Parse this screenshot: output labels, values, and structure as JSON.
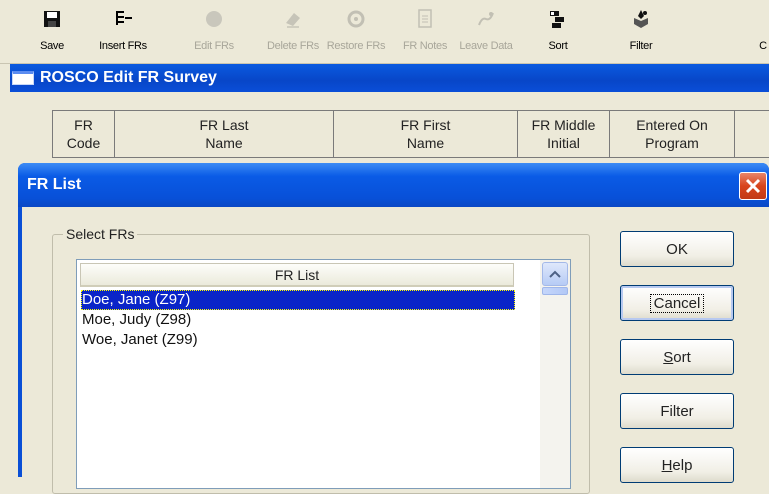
{
  "toolbar": {
    "items": [
      {
        "label": "Save",
        "icon": "floppy-disk-icon",
        "enabled": true
      },
      {
        "label": "Insert FRs",
        "icon": "insert-rows-icon",
        "enabled": true
      },
      {
        "label": "Edit FRs",
        "icon": "edit-circle-icon",
        "enabled": false
      },
      {
        "label": "Delete FRs",
        "icon": "eraser-icon",
        "enabled": false
      },
      {
        "label": "Restore FRs",
        "icon": "restore-icon",
        "enabled": false
      },
      {
        "label": "FR Notes",
        "icon": "notes-icon",
        "enabled": false
      },
      {
        "label": "Leave Data",
        "icon": "leave-icon",
        "enabled": false
      },
      {
        "label": "Sort",
        "icon": "sort-icon",
        "enabled": true
      },
      {
        "label": "Filter",
        "icon": "filter-icon",
        "enabled": true
      },
      {
        "label": "C",
        "icon": "",
        "enabled": true
      }
    ]
  },
  "main_window": {
    "title": "ROSCO Edit FR Survey",
    "columns": [
      {
        "line1": "FR",
        "line2": "Code"
      },
      {
        "line1": "FR Last",
        "line2": "Name"
      },
      {
        "line1": "FR First",
        "line2": "Name"
      },
      {
        "line1": "FR Middle",
        "line2": "Initial"
      },
      {
        "line1": "Entered On",
        "line2": "Program"
      },
      {
        "line1": "",
        "line2": ""
      }
    ]
  },
  "dialog": {
    "title": "FR List",
    "group_label": "Select FRs",
    "list_header": "FR List",
    "items": [
      {
        "text": "Doe, Jane (Z97)",
        "selected": true
      },
      {
        "text": "Moe, Judy (Z98)",
        "selected": false
      },
      {
        "text": "Woe, Janet (Z99)",
        "selected": false
      }
    ],
    "buttons": {
      "ok": "OK",
      "cancel": "Cancel",
      "sort_pre": "",
      "sort_ul": "S",
      "sort_post": "ort",
      "filter": "Filter",
      "help_pre": "",
      "help_ul": "H",
      "help_post": "elp"
    }
  },
  "colors": {
    "title_bar": "#0a4fd6",
    "selection": "#0a24c8",
    "close_button": "#d8451c"
  }
}
